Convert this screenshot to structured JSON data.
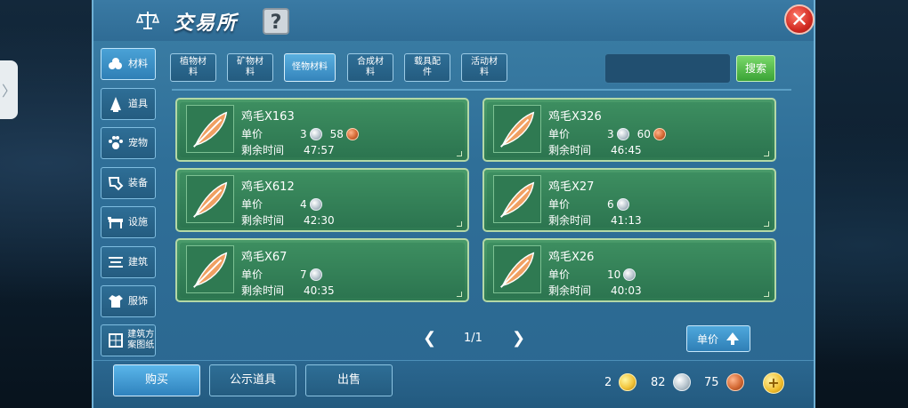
{
  "window": {
    "title": "交易所",
    "help_label": "?",
    "close_label": "✕",
    "side_tab_label": "〉"
  },
  "categories": [
    {
      "label": "材料",
      "icon": "materials-icon",
      "active": true
    },
    {
      "label": "道具",
      "icon": "item-icon",
      "active": false
    },
    {
      "label": "宠物",
      "icon": "pet-paw-icon",
      "active": false
    },
    {
      "label": "装备",
      "icon": "equipment-icon",
      "active": false
    },
    {
      "label": "设施",
      "icon": "facility-icon",
      "active": false
    },
    {
      "label": "建筑",
      "icon": "building-icon",
      "active": false
    },
    {
      "label": "服饰",
      "icon": "clothing-icon",
      "active": false
    },
    {
      "label": "建筑方案图纸",
      "icon": "blueprint-icon",
      "active": false
    }
  ],
  "subtabs": [
    {
      "label": "植物材料",
      "active": false
    },
    {
      "label": "矿物材料",
      "active": false
    },
    {
      "label": "怪物材料",
      "active": true
    },
    {
      "label": "合成材料",
      "active": false
    },
    {
      "label": "载具配件",
      "active": false
    },
    {
      "label": "活动材料",
      "active": false
    }
  ],
  "search": {
    "placeholder": "",
    "button_label": "搜索"
  },
  "price_label": "单价",
  "time_label": "剩余时间",
  "listings": [
    {
      "name": "鸡毛X163",
      "silver": "3",
      "copper": "58",
      "time": "47:57",
      "icon": "feather-icon"
    },
    {
      "name": "鸡毛X326",
      "silver": "3",
      "copper": "60",
      "time": "46:45",
      "icon": "feather-icon"
    },
    {
      "name": "鸡毛X612",
      "silver": "4",
      "copper": "",
      "time": "42:30",
      "icon": "feather-icon"
    },
    {
      "name": "鸡毛X27",
      "silver": "6",
      "copper": "",
      "time": "41:13",
      "icon": "feather-icon"
    },
    {
      "name": "鸡毛X67",
      "silver": "7",
      "copper": "",
      "time": "40:35",
      "icon": "feather-icon"
    },
    {
      "name": "鸡毛X26",
      "silver": "10",
      "copper": "",
      "time": "40:03",
      "icon": "feather-icon"
    }
  ],
  "pager": {
    "prev": "❮",
    "text": "1/1",
    "next": "❯"
  },
  "sort_button": {
    "label": "单价"
  },
  "bottom": {
    "buy_label": "购买",
    "public_label": "公示道具",
    "sell_label": "出售",
    "gold": "2",
    "silver": "82",
    "copper": "75",
    "add_label": "+"
  },
  "colors": {
    "card": "#2f7a52",
    "panel": "#2f6f98",
    "accent_green": "#3aa336",
    "close_red": "#d22b22"
  }
}
